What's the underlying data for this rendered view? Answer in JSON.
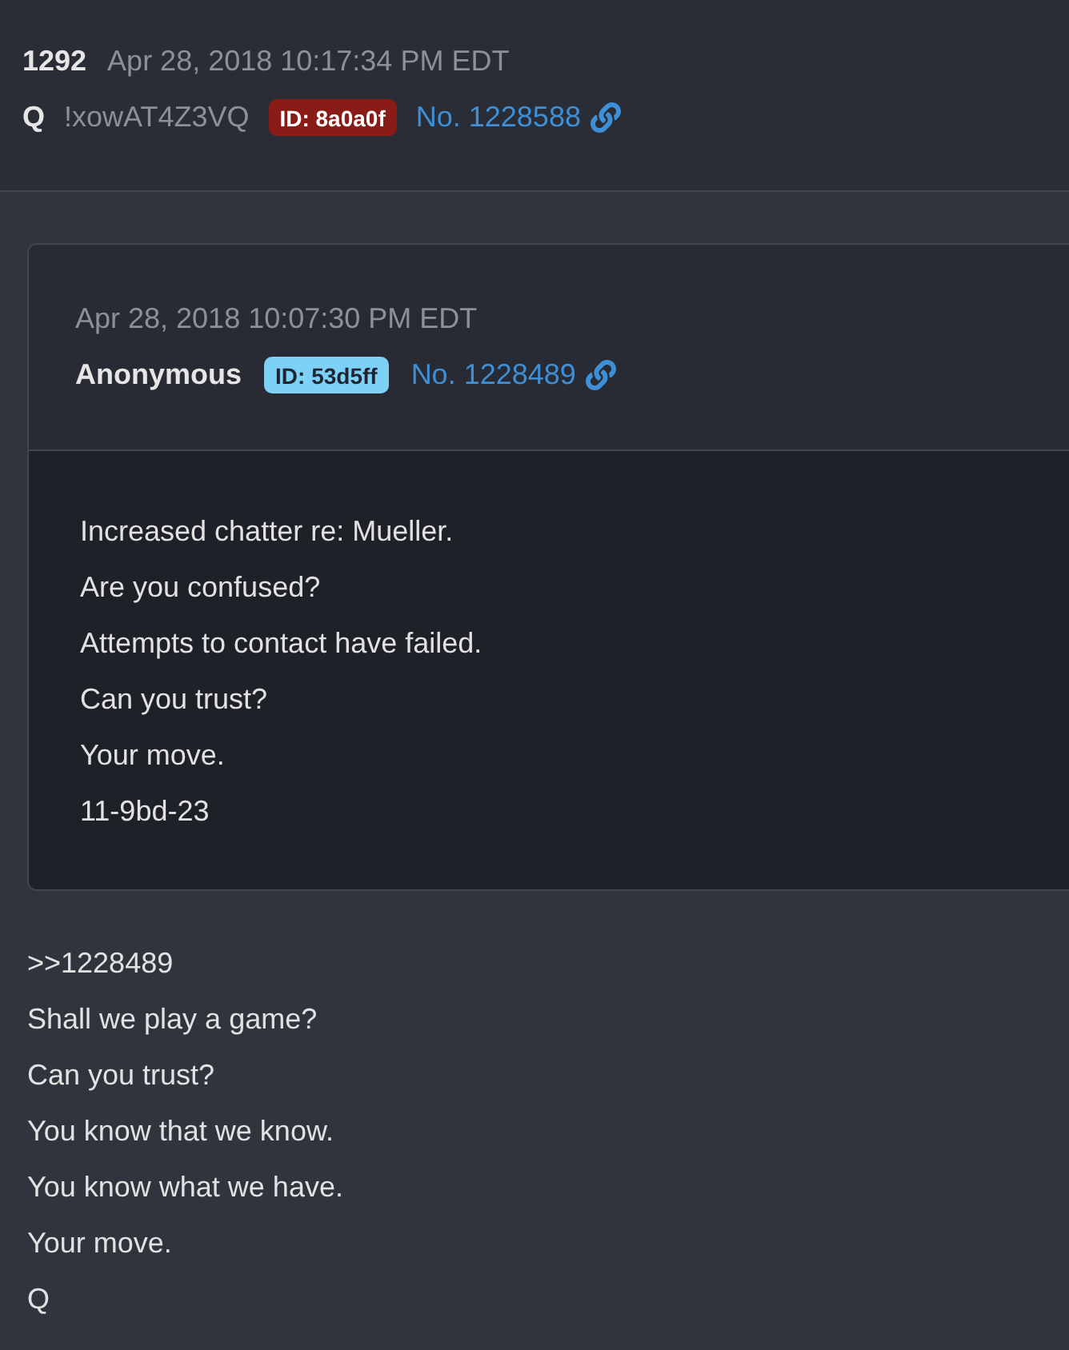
{
  "post": {
    "number": "1292",
    "date": "Apr 28, 2018 10:17:34 PM EDT",
    "author": "Q",
    "tripcode": "!xowAT4Z3VQ",
    "id_badge": {
      "text": "ID: 8a0a0f",
      "color": "#8a1c17"
    },
    "post_link": "No. 1228588"
  },
  "quoted_post": {
    "date": "Apr 28, 2018 10:07:30 PM EDT",
    "author": "Anonymous",
    "id_badge": {
      "text": "ID: 53d5ff",
      "color": "#7dd1f7"
    },
    "post_link": "No. 1228489",
    "lines": [
      "Increased chatter re: Mueller.",
      "Are you confused?",
      "Attempts to contact have failed.",
      "Can you trust?",
      "Your move.",
      "11-9bd-23"
    ]
  },
  "body_lines": [
    ">>1228489",
    "Shall we play a game?",
    "Can you trust?",
    "You know that we know.",
    "You know what we have.",
    "Your move.",
    "Q"
  ]
}
